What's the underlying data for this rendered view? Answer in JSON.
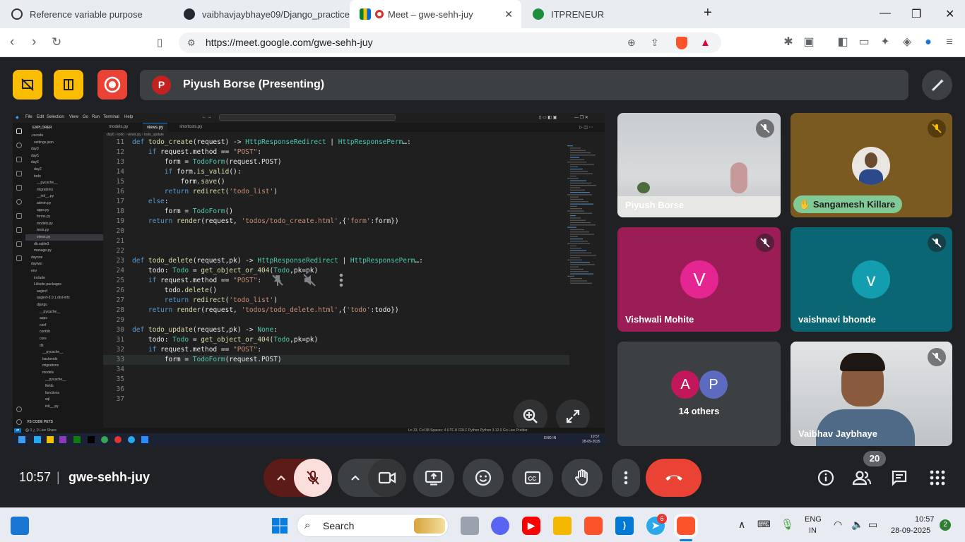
{
  "browser": {
    "tabs": [
      {
        "title": "Reference variable purpose",
        "icon": "openai-icon"
      },
      {
        "title": "vaibhavjaybhaye09/Django_practice",
        "icon": "github-icon"
      },
      {
        "title": "Meet – gwe-sehh-juy",
        "icon": "meet-icon"
      },
      {
        "title": "ITPRENEUR",
        "icon": "itpreneur-icon"
      }
    ],
    "url": "https://meet.google.com/gwe-sehh-juy"
  },
  "meet": {
    "presenter_initial": "P",
    "presenter_label": "Piyush Borse (Presenting)",
    "clock": "10:57",
    "meeting_code": "gwe-sehh-juy",
    "participants_count": "20",
    "colors": {
      "accent_yellow": "#fbbc04",
      "record_red": "#ea4335",
      "hangup_red": "#ea4335",
      "mute_pink": "#f9dedc"
    }
  },
  "participants": [
    {
      "name": "Piyush Borse"
    },
    {
      "name": "Sangamesh Killare"
    },
    {
      "name": "Vishwali Mohite",
      "initial": "V",
      "color": "#e52592",
      "bg": "#9a1d55"
    },
    {
      "name": "vaishnavi bhonde",
      "initial": "v",
      "color": "#129eaf",
      "bg": "#0a6672"
    },
    {
      "others_label": "14 others",
      "initials": [
        "A",
        "P"
      ]
    },
    {
      "name": "Vaibhav Jaybhaye"
    }
  ],
  "vscode": {
    "menu": [
      "File",
      "Edit",
      "Selection",
      "View",
      "Go",
      "Run",
      "Terminal",
      "Help"
    ],
    "explorer_title": "EXPLORER",
    "tabs": [
      "models.py",
      "views.py",
      "shortcuts.py"
    ],
    "breadcrumb": "day6 › todo › views.py › todo_update",
    "explorer_rows": [
      ".vscode",
      "settings.json",
      "day3",
      "day5",
      "day6",
      "day2",
      "todo",
      "__pycache__",
      "migrations",
      "__init__.py",
      "admin.py",
      "apps.py",
      "forms.py",
      "models.py",
      "tests.py",
      "views.py",
      "db.sqlite3",
      "manage.py",
      "dayone",
      "daytwo",
      "env",
      "include",
      "Lib\\site-packages",
      "asgiref",
      "asgiref-3.9.1.dist-info",
      "django",
      "__pycache__",
      "apps",
      "conf",
      "contrib",
      "core",
      "db",
      "__pycache__",
      "backends",
      "migrations",
      "models",
      "__pycache__",
      "fields",
      "functions",
      "sql",
      "init__.py"
    ],
    "outline_label": "VS CODE PETS",
    "status_left": "⨂ 0 △ 0   Live Share",
    "status_right": "Ln 33, Col 38   Spaces: 4   UTF-8   CRLF   Python   Python 3.12.0   Go Live   Prettier",
    "taskbar_time": "10:57",
    "taskbar_date": "28-09-2025",
    "taskbar_lang": "ENG IN",
    "code_lines": [
      {
        "n": "11",
        "t": "def todo_create(request) -> HttpResponseRedirect | HttpResponsePerm…:"
      },
      {
        "n": "12",
        "t": "    if request.method == \"POST\":"
      },
      {
        "n": "13",
        "t": "        form = TodoForm(request.POST)"
      },
      {
        "n": "14",
        "t": "        if form.is_valid():"
      },
      {
        "n": "15",
        "t": "            form.save()"
      },
      {
        "n": "16",
        "t": "        return redirect('todo_list')"
      },
      {
        "n": "17",
        "t": "    else:"
      },
      {
        "n": "18",
        "t": "        form = TodoForm()"
      },
      {
        "n": "19",
        "t": "    return render(request, 'todos/todo_create.html',{'form':form})"
      },
      {
        "n": "20",
        "t": ""
      },
      {
        "n": "21",
        "t": ""
      },
      {
        "n": "22",
        "t": ""
      },
      {
        "n": "23",
        "t": "def todo_delete(request,pk) -> HttpResponseRedirect | HttpResponsePerm…:"
      },
      {
        "n": "24",
        "t": "    todo: Todo = get_object_or_404(Todo,pk=pk)"
      },
      {
        "n": "25",
        "t": "    if request.method == \"POST\":"
      },
      {
        "n": "26",
        "t": "        todo.delete()"
      },
      {
        "n": "27",
        "t": "        return redirect('todo_list')"
      },
      {
        "n": "28",
        "t": "    return render(request, 'todos/todo_delete.html',{'todo':todo})"
      },
      {
        "n": "29",
        "t": ""
      },
      {
        "n": "30",
        "t": "def todo_update(request,pk) -> None:"
      },
      {
        "n": "31",
        "t": "    todo: Todo = get_object_or_404(Todo,pk=pk)"
      },
      {
        "n": "32",
        "t": "    if request.method == \"POST\":"
      },
      {
        "n": "33",
        "t": "        form = TodoForm(request.POST)"
      },
      {
        "n": "34",
        "t": ""
      },
      {
        "n": "35",
        "t": ""
      },
      {
        "n": "36",
        "t": ""
      },
      {
        "n": "37",
        "t": ""
      }
    ]
  },
  "taskbar": {
    "search_label": "Search",
    "lang": "ENG",
    "region": "IN",
    "time": "10:57",
    "date": "28-09-2025",
    "notification_count": "2",
    "telegram_badge": "6"
  }
}
